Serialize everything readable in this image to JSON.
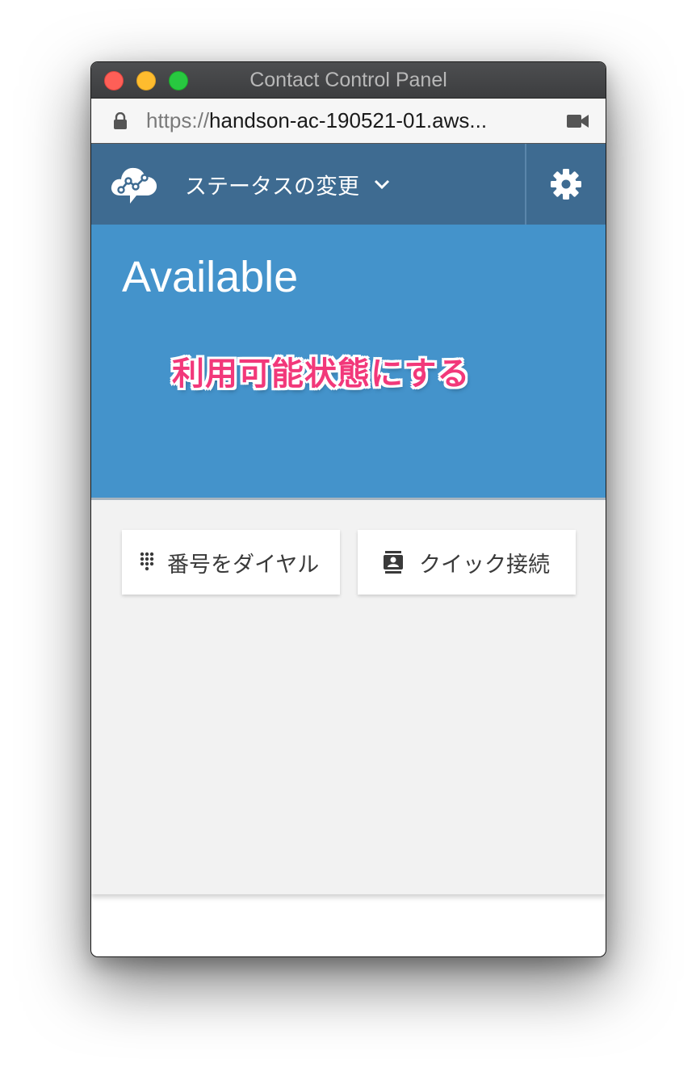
{
  "window": {
    "title": "Contact Control Panel"
  },
  "address_bar": {
    "scheme": "https://",
    "host": "handson-ac-190521-01.aws...",
    "icons": [
      "lock-icon",
      "camera-icon"
    ]
  },
  "nav": {
    "logo_icon": "cloud-logo-icon",
    "status_dropdown_label": "ステータスの変更",
    "dropdown_icon": "chevron-down-icon",
    "settings_icon": "gear-icon"
  },
  "status": {
    "current": "Available"
  },
  "annotation": {
    "text": "利用可能状態にする",
    "color": "#f2387a"
  },
  "actions": {
    "dial_number_label": "番号をダイヤル",
    "dial_number_icon": "dialpad-icon",
    "quick_connect_label": "クイック接続",
    "quick_connect_icon": "contact-book-icon"
  },
  "colors": {
    "nav_bg": "#3e6b91",
    "status_bg": "#4493cb",
    "body_bg": "#f2f2f2"
  }
}
